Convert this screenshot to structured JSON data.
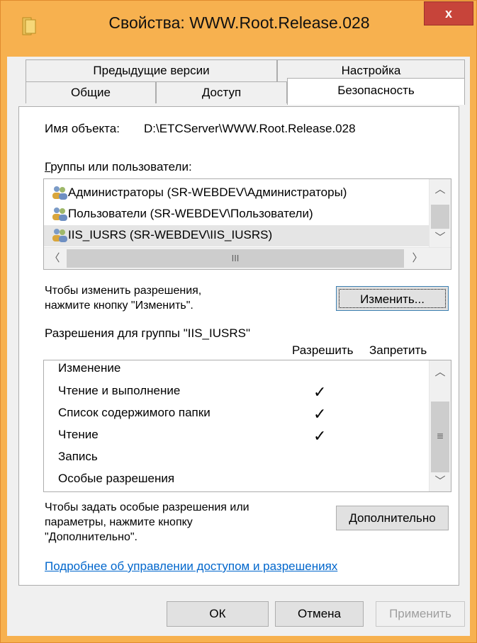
{
  "window": {
    "title": "Свойства: WWW.Root.Release.028",
    "close_label": "x"
  },
  "tabs": {
    "row1": [
      "Предыдущие версии",
      "Настройка"
    ],
    "row2": [
      "Общие",
      "Доступ",
      "Безопасность"
    ],
    "active": "Безопасность"
  },
  "object": {
    "label": "Имя объекта:",
    "value": "D:\\ETCServer\\WWW.Root.Release.028"
  },
  "groups": {
    "label": "Группы или пользователи:",
    "items": [
      "Администраторы (SR-WEBDEV\\Администраторы)",
      "Пользователи (SR-WEBDEV\\Пользователи)",
      "IIS_IUSRS (SR-WEBDEV\\IIS_IUSRS)"
    ],
    "selected_index": 2,
    "hscroll_grip": "III"
  },
  "change": {
    "hint_line1": "Чтобы изменить разрешения,",
    "hint_line2": "нажмите кнопку \"Изменить\".",
    "button": "Изменить..."
  },
  "permissions": {
    "label": "Разрешения для группы \"IIS_IUSRS\"",
    "allow_header": "Разрешить",
    "deny_header": "Запретить",
    "rows": [
      {
        "name": "Изменение",
        "allow": false,
        "deny": false
      },
      {
        "name": "Чтение и выполнение",
        "allow": true,
        "deny": false
      },
      {
        "name": "Список содержимого папки",
        "allow": true,
        "deny": false
      },
      {
        "name": "Чтение",
        "allow": true,
        "deny": false
      },
      {
        "name": "Запись",
        "allow": false,
        "deny": false
      },
      {
        "name": "Особые разрешения",
        "allow": false,
        "deny": false
      }
    ],
    "check_glyph": "✓",
    "vscroll_grip": "≡"
  },
  "advanced": {
    "hint_line1": "Чтобы задать особые разрешения или",
    "hint_line2": "параметры, нажмите кнопку",
    "hint_line3": "\"Дополнительно\".",
    "button": "Дополнительно"
  },
  "link": "Подробнее об управлении доступом и разрешениях",
  "footer": {
    "ok": "ОК",
    "cancel": "Отмена",
    "apply": "Применить"
  },
  "colors": {
    "titlebar": "#f7b14f",
    "close": "#c7443a",
    "link": "#0066cc"
  }
}
